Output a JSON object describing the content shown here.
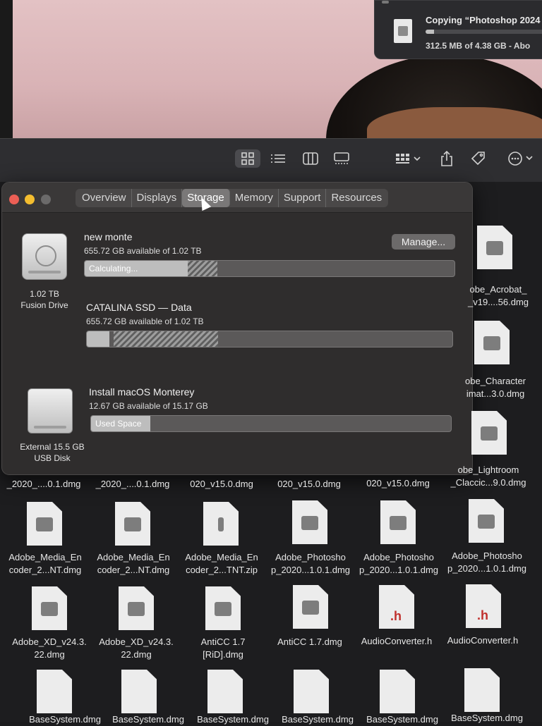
{
  "notification": {
    "title": "Copying “Photoshop 2024 (",
    "progress": 0.07,
    "detail": "312.5 MB of 4.38 GB - Abo"
  },
  "toolbar": {
    "icons": [
      "icon-view-grid-icon",
      "list-view-icon",
      "column-view-icon",
      "gallery-view-icon",
      "group-by-icon",
      "share-icon",
      "tag-icon",
      "more-actions-icon"
    ]
  },
  "window": {
    "tabs": [
      "Overview",
      "Displays",
      "Storage",
      "Memory",
      "Support",
      "Resources"
    ],
    "active_tab": "Storage",
    "disk1": {
      "caption1": "1.02 TB",
      "caption2": "Fusion Drive"
    },
    "disk2": {
      "caption1": "External 15.5 GB",
      "caption2": "USB Disk"
    },
    "manage_label": "Manage...",
    "volumes": [
      {
        "name": "new monte",
        "detail": "655.72 GB available of 1.02 TB",
        "bar_label": "Calculating..."
      },
      {
        "name": "CATALINA SSD — Data",
        "detail": "655.72 GB available of 1.02 TB",
        "bar_label": ""
      },
      {
        "name": "Install macOS Monterey",
        "detail": "12.67 GB available of 15.17 GB",
        "bar_label": "Used Space"
      }
    ]
  },
  "finder": {
    "partial_names": [
      {
        "l1": "obe_Acrobat_",
        "l2": "_v19....56.dmg"
      },
      {
        "l1": "obe_Character",
        "l2": "imat...3.0.dmg"
      },
      {
        "l1": "obe_Lightroom",
        "l2": "_Claccic...9.0.dmg"
      }
    ],
    "row1": [
      "_2020_....0.1.dmg",
      "_2020_....0.1.dmg",
      "020_v15.0.dmg",
      "020_v15.0.dmg",
      "020_v15.0.dmg"
    ],
    "row2": [
      {
        "l1": "Adobe_Media_En",
        "l2": "coder_2...NT.dmg"
      },
      {
        "l1": "Adobe_Media_En",
        "l2": "coder_2...NT.dmg"
      },
      {
        "l1": "Adobe_Media_En",
        "l2": "coder_2...TNT.zip"
      },
      {
        "l1": "Adobe_Photosho",
        "l2": "p_2020...1.0.1.dmg"
      },
      {
        "l1": "Adobe_Photosho",
        "l2": "p_2020...1.0.1.dmg"
      },
      {
        "l1": "Adobe_Photosho",
        "l2": "p_2020...1.0.1.dmg"
      }
    ],
    "row3": [
      {
        "l1": "Adobe_XD_v24.3.",
        "l2": "22.dmg"
      },
      {
        "l1": "Adobe_XD_v24.3.",
        "l2": "22.dmg"
      },
      {
        "l1": "AntiCC 1.7",
        "l2": "[RiD].dmg"
      },
      {
        "l1": "AntiCC 1.7.dmg",
        "l2": ""
      },
      {
        "l1": "AudioConverter.h",
        "l2": ""
      },
      {
        "l1": "AudioConverter.h",
        "l2": ""
      }
    ],
    "row4": [
      "BaseSystem.dmg",
      "BaseSystem.dmg",
      "BaseSystem.dmg",
      "BaseSystem.dmg",
      "BaseSystem.dmg",
      "BaseSystem.dmg"
    ]
  }
}
